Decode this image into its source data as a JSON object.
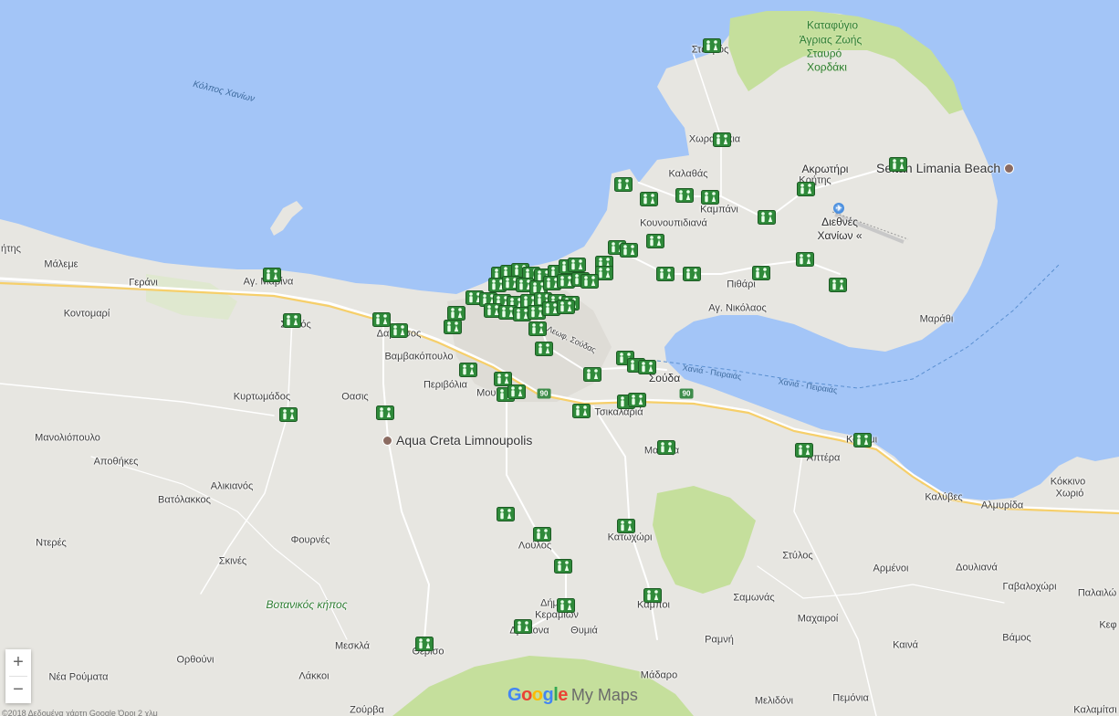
{
  "colors": {
    "sea": "#a3c5f7",
    "land": "#e7e6e1",
    "park": "#c5df9c",
    "road": "#ffffff",
    "highway": "#f6cf6a",
    "marker": "#2f8a3a"
  },
  "labels": {
    "water_gulf": "Κόλπος Χανίων",
    "reserve_l1": "Καταφύγιο",
    "reserve_l2": "Άγριας Ζωής",
    "reserve_l3": "Σταυρό",
    "reserve_l4": "Χορδάκι",
    "stavros": "Σταυρός",
    "chorafakia": "Χωραφάκια",
    "kalathas": "Καλαθάς",
    "akrotiri_l1": "Ακρωτήρι",
    "akrotiri_l2": "Κρήτης",
    "kambani": "Καμπάνι",
    "kounoupidiana": "Κουνουπιδιανά",
    "airport_l1": "Διεθνές",
    "airport_l2": "Χανίων «",
    "pithari": "Πιθάρι",
    "ag_nikolaos": "Αγ. Νικόλαος",
    "marathi": "Μαράθι",
    "maleme": "Μάλεμε",
    "gerani": "Γεράνι",
    "ag_marina": "Αγ. Μαρίνα",
    "kontomari": "Κοντομαρί",
    "stalos": "Σταλός",
    "daratsos": "Δαράτσος",
    "vamvakopoulo": "Βαμβακόπουλο",
    "perivolia": "Περιβόλια",
    "mournies": "Μουρνιές",
    "kyrtomados": "Κυρτωμάδος",
    "oasis": "Οασις",
    "souda": "Σούδα",
    "tsikalaria": "Τσικαλαριά",
    "manolioupolo": "Μανολιόπουλο",
    "apothikes": "Αποθήκες",
    "alikianos": "Αλικιανός",
    "vatolakkos": "Βατόλακκος",
    "malaxa": "Μαλάξα",
    "aptera": "Απτέρα",
    "kalami": "Καλάμι",
    "kalyves": "Καλύβες",
    "almyrida": "Αλμυρίδα",
    "kokkino_l1": "Κόκκινο",
    "kokkino_l2": "Χωριό",
    "nteres": "Ντερές",
    "fournes": "Φουρνές",
    "loulos": "Λούλος",
    "katochori": "Κατωχώρι",
    "skines": "Σκινές",
    "stylos": "Στύλος",
    "armenoi": "Αρμένοι",
    "doulianа": "Δουλιανά",
    "gavalochori": "Γαβαλοχώρι",
    "palailoni": "Παλαιλώ",
    "botanikos": "Βοτανικός κήπος",
    "dimos_kerameion_l1": "Δήμ",
    "dimos_kerameion_l2": "Κεραμιών",
    "samonas": "Σαμωνάς",
    "kampoi": "Καμποι",
    "drakona": "Δράκονα",
    "thymia": "Θυμιά",
    "machairoi": "Μαχαιροί",
    "vamos": "Βάμος",
    "kefalas": "Κεφ",
    "orthouni": "Ορθούνι",
    "meskla": "Μεσκλά",
    "therisso": "Θέρισο",
    "ramni": "Ραμνή",
    "kaina": "Καινά",
    "nea_roumata": "Νέα Ρούματα",
    "lakkoi": "Λάκκοι",
    "madaro": "Μάδαρο",
    "zourva": "Ζούρβα",
    "melidoni": "Μελιδόνι",
    "pemonia": "Πεμόνια",
    "kalamitsi": "Καλαμίτσι",
    "itis": "ήτης",
    "ferry1": "Χανιά - Πειραιάς",
    "ferry2": "Χανιά - Πειραιάς",
    "road_soudas": "Λεωφ. Σούδας",
    "hw_90_a": "90",
    "hw_90_b": "90"
  },
  "pois": {
    "seitan": "Seitan Limania Beach",
    "aqua_creta": "Aqua Creta Limnoupolis"
  },
  "controls": {
    "zoom_in": "+",
    "zoom_out": "−"
  },
  "brand": {
    "google_letters": [
      "G",
      "o",
      "o",
      "g",
      "l",
      "e"
    ],
    "google_colors": [
      "#4285f4",
      "#ea4335",
      "#fbbc05",
      "#4285f4",
      "#34a853",
      "#ea4335"
    ],
    "product": "My Maps"
  },
  "attribution": "©2018 Δεδομένα χάρτη Google   Όροι   2 χλμ"
}
